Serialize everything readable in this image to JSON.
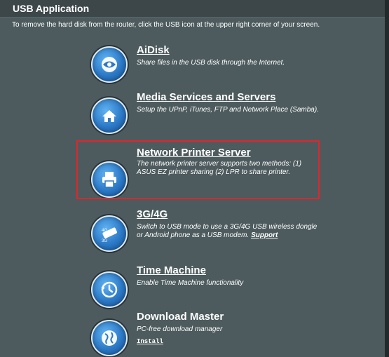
{
  "header": {
    "title": "USB Application"
  },
  "subheader": {
    "text": "To remove the hard disk from the router, click the USB icon at the upper right corner of your screen."
  },
  "items": [
    {
      "title": "AiDisk",
      "desc": "Share files in the USB disk through the Internet.",
      "icon": "aidisk-icon"
    },
    {
      "title": "Media Services and Servers",
      "desc": "Setup the UPnP, iTunes, FTP and Network Place (Samba).",
      "icon": "media-server-icon"
    },
    {
      "title": "Network Printer Server",
      "desc": "The network printer server supports two methods: (1) ASUS EZ printer sharing (2) LPR to share printer.",
      "icon": "printer-icon"
    },
    {
      "title": "3G/4G",
      "desc": "Switch to USB mode to use a 3G/4G USB wireless dongle or Android phone as a USB modem.",
      "link": "Support",
      "icon": "usb-modem-icon"
    },
    {
      "title": "Time Machine",
      "desc": "Enable Time Machine functionality",
      "icon": "time-machine-icon"
    },
    {
      "title": "Download Master",
      "desc": "PC-free download manager",
      "install": "Install",
      "icon": "download-master-icon"
    }
  ],
  "colors": {
    "highlight": "#e0262b",
    "icon": "#2b78c6",
    "background": "#4d5b5e"
  }
}
